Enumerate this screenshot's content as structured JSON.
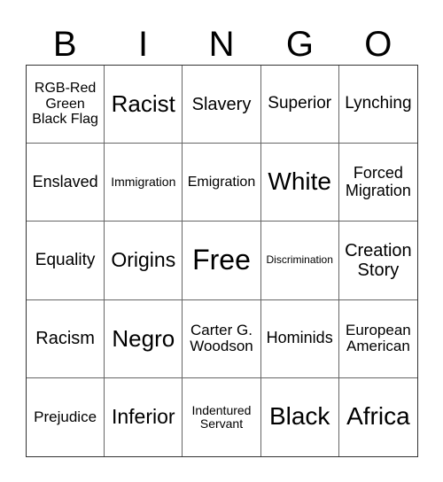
{
  "header": {
    "letters": [
      "B",
      "I",
      "N",
      "G",
      "O"
    ]
  },
  "cells": [
    "RGB-Red Green Black Flag",
    "Racist",
    "Slavery",
    "Superior",
    "Lynching",
    "Enslaved",
    "Immigration",
    "Emigration",
    "White",
    "Forced Migration",
    "Equality",
    "Origins",
    "Free",
    "Discrimination",
    "Creation Story",
    "Racism",
    "Negro",
    "Carter G. Woodson",
    "Hominids",
    "European American",
    "Prejudice",
    "Inferior",
    "Indentured Servant",
    "Black",
    "Africa"
  ]
}
